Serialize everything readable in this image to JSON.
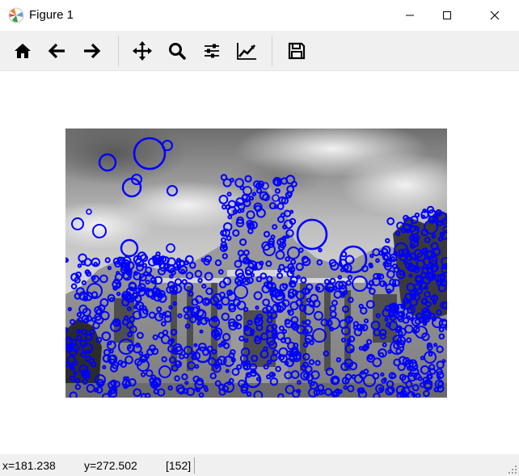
{
  "window": {
    "title": "Figure 1",
    "controls": [
      "minimize",
      "maximize",
      "close"
    ]
  },
  "toolbar": {
    "buttons": [
      {
        "icon": "home-icon",
        "tooltip": "Home"
      },
      {
        "icon": "back-arrow-icon",
        "tooltip": "Back"
      },
      {
        "icon": "forward-arrow-icon",
        "tooltip": "Forward"
      },
      {
        "icon": "pan-icon",
        "tooltip": "Pan"
      },
      {
        "icon": "zoom-icon",
        "tooltip": "Zoom"
      },
      {
        "icon": "subplots-icon",
        "tooltip": "Configure subplots"
      },
      {
        "icon": "edit-axis-icon",
        "tooltip": "Edit axis"
      },
      {
        "icon": "save-icon",
        "tooltip": "Save"
      }
    ]
  },
  "figure": {
    "image_description": "grayscale building facade with blob keypoint circles",
    "marker_color": "#0000ff"
  },
  "status": {
    "x_readout": "x=181.238",
    "y_readout": "y=272.502",
    "value_readout": "[152]"
  },
  "colors": {
    "toolbar_bg": "#f0f0f0",
    "marker": "#0000ff"
  }
}
